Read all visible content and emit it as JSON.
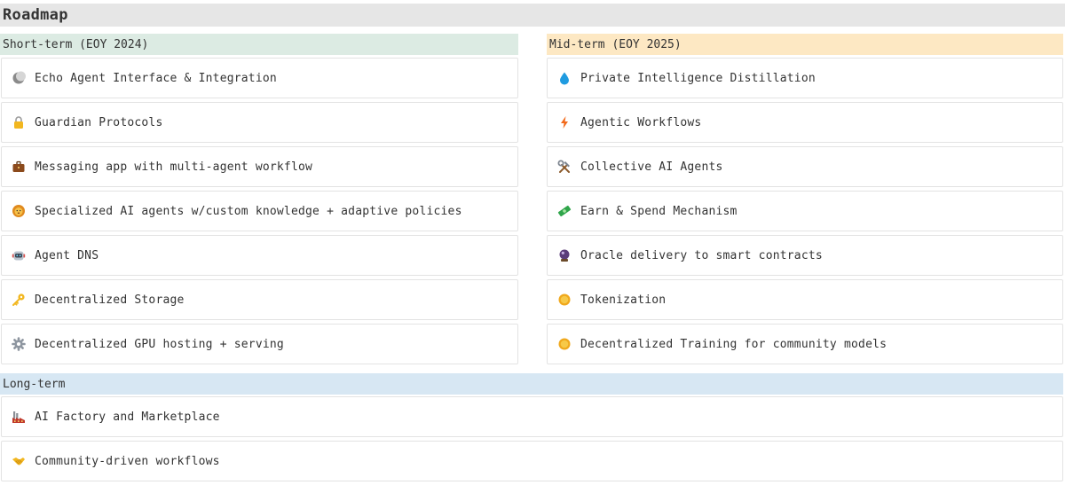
{
  "page": {
    "title": "Roadmap"
  },
  "sections": {
    "short": {
      "header": "Short-term (EOY 2024)",
      "items": [
        {
          "label": "Echo Agent Interface & Integration",
          "icon": "moon-icon"
        },
        {
          "label": "Guardian Protocols",
          "icon": "lock-icon"
        },
        {
          "label": "Messaging app with multi-agent workflow",
          "icon": "briefcase-icon"
        },
        {
          "label": "Specialized AI agents w/custom knowledge + adaptive policies",
          "icon": "lion-face-icon"
        },
        {
          "label": "Agent DNS",
          "icon": "robot-icon"
        },
        {
          "label": "Decentralized Storage",
          "icon": "key-icon"
        },
        {
          "label": "Decentralized GPU hosting + serving",
          "icon": "gear-icon"
        }
      ]
    },
    "mid": {
      "header": "Mid-term (EOY 2025)",
      "items": [
        {
          "label": "Private Intelligence Distillation",
          "icon": "droplet-icon"
        },
        {
          "label": "Agentic Workflows",
          "icon": "lightning-icon"
        },
        {
          "label": "Collective AI Agents",
          "icon": "tools-icon"
        },
        {
          "label": "Earn & Spend Mechanism",
          "icon": "money-icon"
        },
        {
          "label": "Oracle delivery to smart contracts",
          "icon": "crystal-ball-icon"
        },
        {
          "label": "Tokenization",
          "icon": "coin-icon"
        },
        {
          "label": "Decentralized Training for community models",
          "icon": "coin-icon"
        }
      ]
    },
    "long": {
      "header": "Long-term",
      "items": [
        {
          "label": "AI Factory and Marketplace",
          "icon": "factory-icon"
        },
        {
          "label": "Community-driven workflows",
          "icon": "handshake-icon"
        }
      ]
    }
  }
}
